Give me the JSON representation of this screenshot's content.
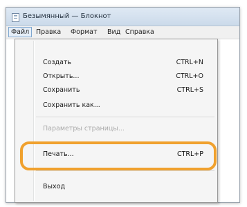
{
  "window": {
    "title": "Безымянный — Блокнот"
  },
  "menubar": [
    "Файл",
    "Правка",
    "Формат",
    "Вид",
    "Справка"
  ],
  "menu": {
    "items": [
      {
        "label": "Создать",
        "shortcut": "CTRL+N"
      },
      {
        "label": "Открыть...",
        "shortcut": "CTRL+O"
      },
      {
        "label": "Сохранить",
        "shortcut": "CTRL+S"
      },
      {
        "label": "Сохранить как..."
      },
      {
        "label": "Параметры страницы..."
      },
      {
        "label": "Печать...",
        "shortcut": "CTRL+P"
      },
      {
        "label": "Выход"
      }
    ]
  },
  "colors": {
    "highlight": "#f0a12e",
    "active_menu_border": "#7ea6cf"
  }
}
